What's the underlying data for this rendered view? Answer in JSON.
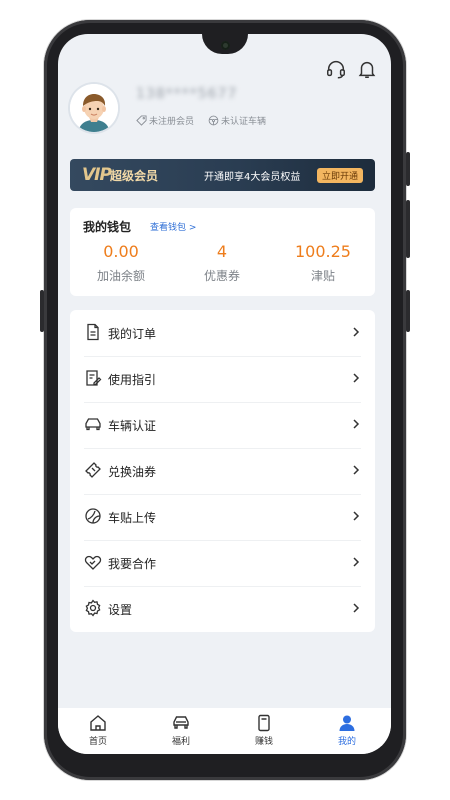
{
  "profile": {
    "phone": "138****5677",
    "tags": [
      "未注册会员",
      "未认证车辆"
    ]
  },
  "vip": {
    "logo": "VIP",
    "title": "超级会员",
    "desc": "开通即享4大会员权益",
    "button": "立即开通"
  },
  "wallet": {
    "title": "我的钱包",
    "link": "查看钱包 >",
    "items": [
      {
        "value": "0.00",
        "label": "加油余额"
      },
      {
        "value": "4",
        "label": "优惠券"
      },
      {
        "value": "100.25",
        "label": "津贴"
      }
    ]
  },
  "menu": {
    "items": [
      {
        "label": "我的订单",
        "icon": "document-icon"
      },
      {
        "label": "使用指引",
        "icon": "guide-icon"
      },
      {
        "label": "车辆认证",
        "icon": "car-icon"
      },
      {
        "label": "兑换油券",
        "icon": "ticket-icon"
      },
      {
        "label": "车贴上传",
        "icon": "sticker-icon"
      },
      {
        "label": "我要合作",
        "icon": "handshake-icon"
      },
      {
        "label": "设置",
        "icon": "gear-icon"
      }
    ]
  },
  "tabbar": {
    "items": [
      {
        "label": "首页",
        "icon": "home-icon"
      },
      {
        "label": "福利",
        "icon": "car-front-icon"
      },
      {
        "label": "赚钱",
        "icon": "wallet-icon"
      },
      {
        "label": "我的",
        "icon": "user-icon",
        "active": true
      }
    ]
  },
  "colors": {
    "accent": "#2d6ee0",
    "value": "#ee7d1c",
    "vip_gold": "#f3b660",
    "vip_bg": "#2a3d52"
  }
}
